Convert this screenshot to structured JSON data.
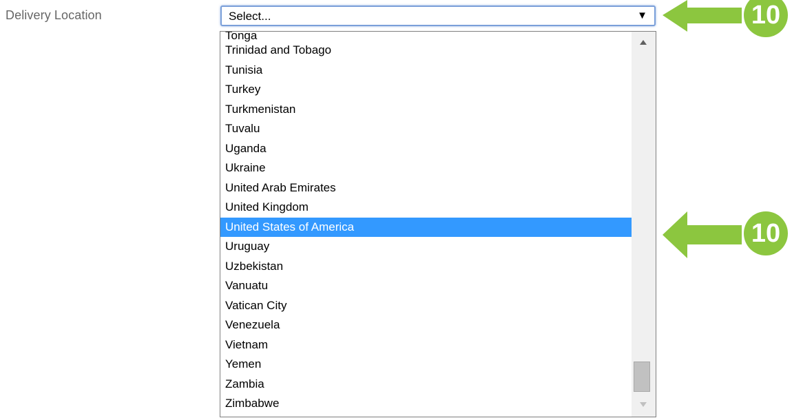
{
  "form": {
    "label": "Delivery Location",
    "select": {
      "value": "Select...",
      "caret_icon": "triangle-down-icon"
    },
    "dropdown": {
      "options": [
        "Tonga",
        "Trinidad and Tobago",
        "Tunisia",
        "Turkey",
        "Turkmenistan",
        "Tuvalu",
        "Uganda",
        "Ukraine",
        "United Arab Emirates",
        "United Kingdom",
        "United States of America",
        "Uruguay",
        "Uzbekistan",
        "Vanuatu",
        "Vatican City",
        "Venezuela",
        "Vietnam",
        "Yemen",
        "Zambia",
        "Zimbabwe"
      ],
      "highlighted": "United States of America"
    }
  },
  "annotations": {
    "top_badge": "10",
    "middle_badge": "10",
    "color": "#8cc63f",
    "highlight_color": "#3399ff"
  }
}
